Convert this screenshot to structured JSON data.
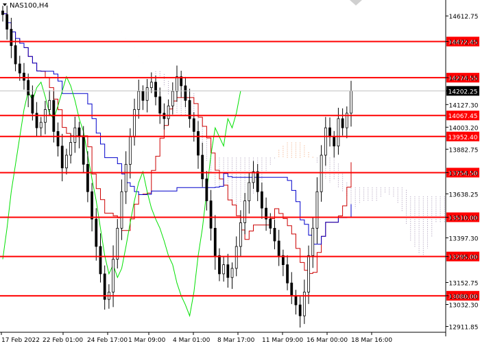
{
  "header": {
    "symbol_timeframe": "NAS100,H4"
  },
  "colors": {
    "background": "#ffffff",
    "level_line": "#ff0000",
    "level_badge": "#ff0000",
    "price_badge": "#000000",
    "candle": "#000000",
    "green_line": "#00e000",
    "red_line": "#cc0000",
    "blue_line": "#0000cc",
    "cloud_orange": "#f0a070",
    "cloud_gray": "#a090b0"
  },
  "chart_data": {
    "type": "candlestick",
    "ylim": [
      12880,
      14700
    ],
    "y_ticks": [
      "14612.75",
      "14472.45",
      "14274.55",
      "14202.25",
      "14127.30",
      "14003.20",
      "13882.75",
      "13754.50",
      "13638.25",
      "13510.00",
      "13397.30",
      "13295.00",
      "13152.75",
      "13080.00",
      "13032.30",
      "12911.85"
    ],
    "y_tick_values": [
      14612.75,
      14472.45,
      14274.55,
      14202.25,
      14127.3,
      14003.2,
      13882.75,
      13754.5,
      13638.25,
      13510.0,
      13397.3,
      13295.0,
      13152.75,
      13080.0,
      13032.3,
      12911.85
    ],
    "x_ticks": [
      "17 Feb 2022",
      "22 Feb 01:00",
      "24 Feb 17:00",
      "1 Mar 09:00",
      "4 Mar 01:00",
      "8 Mar 17:00",
      "11 Mar 09:00",
      "16 Mar 00:00",
      "18 Mar 16:00"
    ],
    "levels": [
      {
        "label": "14472.45",
        "value": 14472.45
      },
      {
        "label": "14274.55",
        "value": 14274.55
      },
      {
        "label": "14067.45",
        "value": 14067.45
      },
      {
        "label": "13952.40",
        "value": 13952.4
      },
      {
        "label": "13754.50",
        "value": 13754.5
      },
      {
        "label": "13510.00",
        "value": 13510.0
      },
      {
        "label": "13295.00",
        "value": 13295.0
      },
      {
        "label": "13080.00",
        "value": 13080.0
      }
    ],
    "current_price": {
      "label": "14202.25",
      "value": 14202.25
    },
    "closes": [
      14620,
      14540,
      14450,
      14350,
      14300,
      14260,
      14180,
      14080,
      14000,
      14030,
      14100,
      14150,
      13980,
      13900,
      13780,
      13850,
      13920,
      14000,
      13950,
      13800,
      13650,
      13500,
      13350,
      13200,
      13060,
      13100,
      13280,
      13450,
      13650,
      13800,
      13950,
      14100,
      14200,
      14150,
      14220,
      14250,
      14170,
      14080,
      14050,
      14120,
      14200,
      14280,
      14230,
      14150,
      14050,
      13980,
      13850,
      13720,
      13600,
      13450,
      13300,
      13200,
      13250,
      13180,
      13230,
      13350,
      13480,
      13600,
      13700,
      13760,
      13650,
      13560,
      13500,
      13450,
      13380,
      13300,
      13250,
      13150,
      13080,
      13030,
      12970,
      13100,
      13300,
      13450,
      13650,
      13850,
      14000,
      13950,
      13900,
      14050,
      14000,
      14080,
      14202
    ]
  }
}
